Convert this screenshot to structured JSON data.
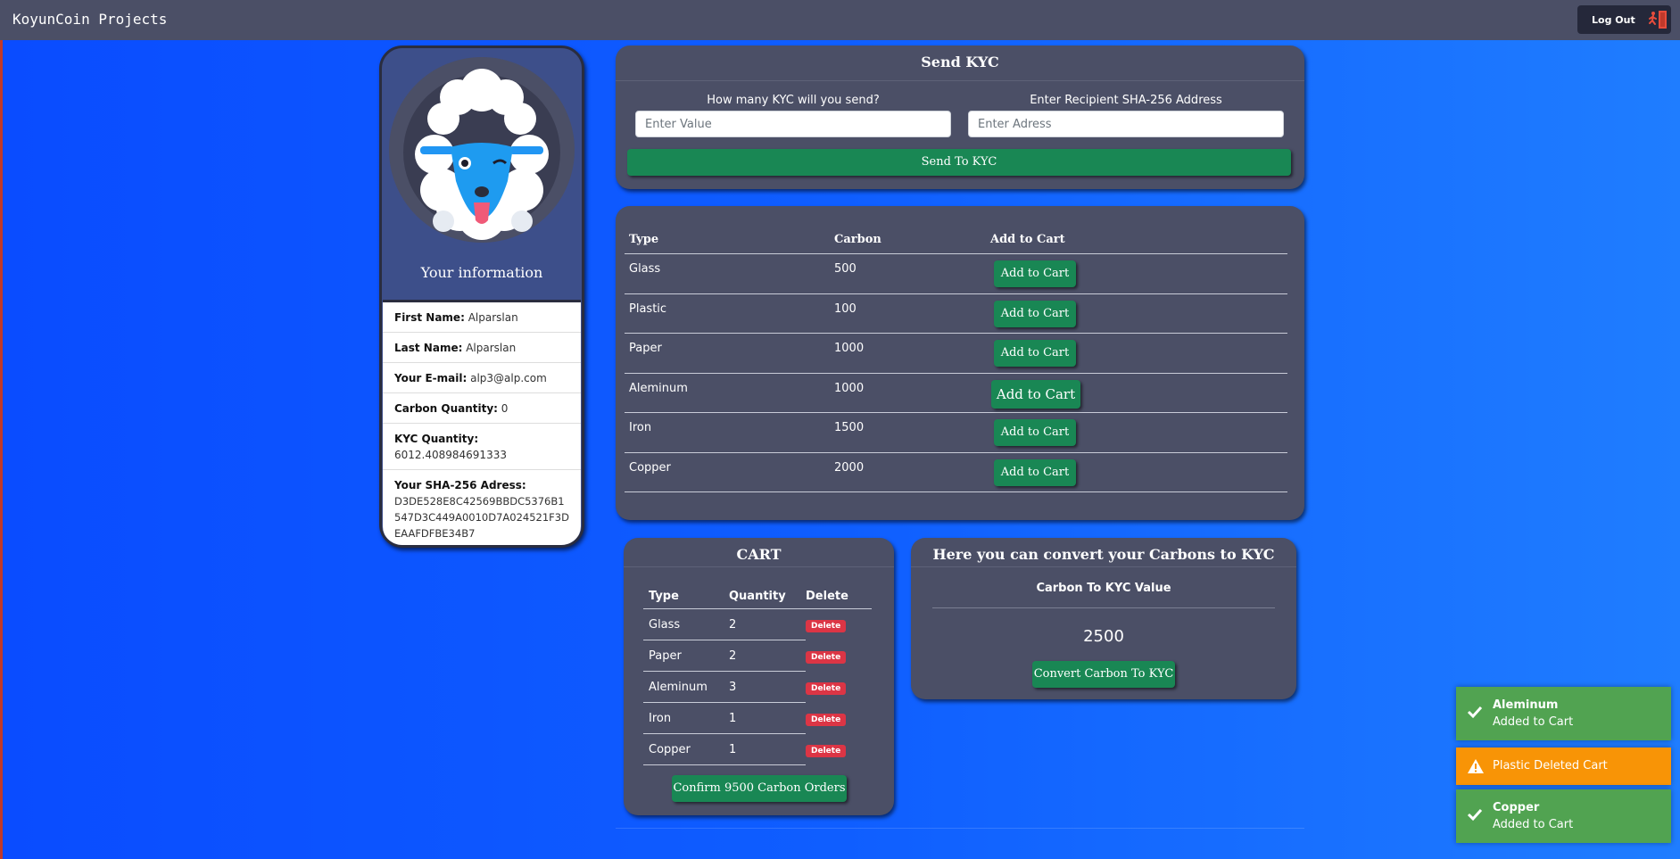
{
  "app": {
    "title": "KoyunCoin Projects"
  },
  "header": {
    "logout_label": "Log Out"
  },
  "profile": {
    "title": "Your information",
    "fields": [
      {
        "label": "First Name:",
        "value": "Alparslan"
      },
      {
        "label": "Last Name:",
        "value": "Alparslan"
      },
      {
        "label": "Your E-mail:",
        "value": "alp3@alp.com"
      },
      {
        "label": "Carbon Quantity:",
        "value": "0"
      },
      {
        "label": "KYC Quantity:",
        "value": "6012.408984691333"
      },
      {
        "label": "Your SHA-256 Adress:",
        "value": "D3DE528E8C42569BBDC5376B1547D3C449A0010D7A024521F3DEAAFDFBE34B7"
      }
    ]
  },
  "send": {
    "title": "Send KYC",
    "amount_label": "How many KYC will you send?",
    "amount_placeholder": "Enter Value",
    "address_label": "Enter Recipient SHA-256 Address",
    "address_placeholder": "Enter Adress",
    "button": "Send To KYC"
  },
  "materials": {
    "headers": [
      "Type",
      "Carbon",
      "Add to Cart"
    ],
    "button_label": "Add to Cart",
    "rows": [
      {
        "type": "Glass",
        "carbon": "500"
      },
      {
        "type": "Plastic",
        "carbon": "100"
      },
      {
        "type": "Paper",
        "carbon": "1000"
      },
      {
        "type": "Aleminum",
        "carbon": "1000"
      },
      {
        "type": "Iron",
        "carbon": "1500"
      },
      {
        "type": "Copper",
        "carbon": "2000"
      }
    ]
  },
  "cart": {
    "title": "CART",
    "headers": [
      "Type",
      "Quantity",
      "Delete"
    ],
    "delete_label": "Delete",
    "rows": [
      {
        "type": "Glass",
        "quantity": "2"
      },
      {
        "type": "Paper",
        "quantity": "2"
      },
      {
        "type": "Aleminum",
        "quantity": "3"
      },
      {
        "type": "Iron",
        "quantity": "1"
      },
      {
        "type": "Copper",
        "quantity": "1"
      }
    ],
    "confirm_button": "Confirm 9500 Carbon Orders"
  },
  "convert": {
    "title": "Here you can convert your Carbons to KYC",
    "label": "Carbon To KYC Value",
    "value": "2500",
    "button": "Convert Carbon To KYC"
  },
  "toasts": [
    {
      "kind": "success",
      "title": "Aleminum",
      "message": "Added to Cart",
      "color": "#51a351",
      "icon": "check-icon"
    },
    {
      "kind": "warning",
      "title": "",
      "message": "Plastic Deleted Cart",
      "color": "#f89406",
      "icon": "warning-icon"
    },
    {
      "kind": "success",
      "title": "Copper",
      "message": "Added to Cart",
      "color": "#51a351",
      "icon": "check-icon"
    }
  ],
  "colors": {
    "topbar": "#4b4f66",
    "card": "#4b4f66",
    "primary_button": "#198754",
    "delete_button": "#dc3545",
    "background": "#0a4cff"
  }
}
